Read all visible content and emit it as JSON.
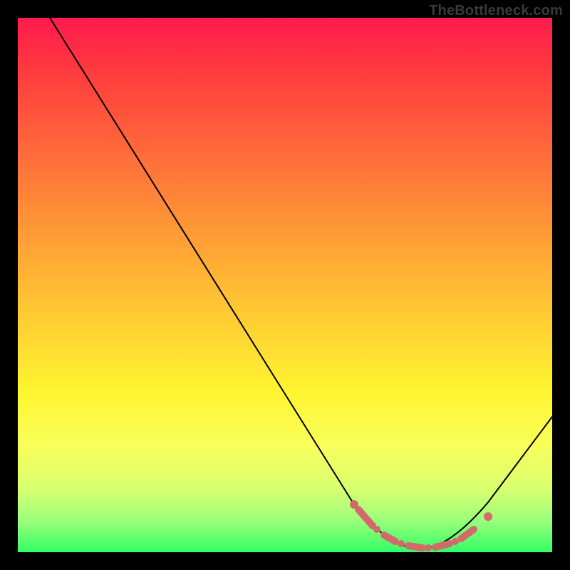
{
  "watermark": "TheBottleneck.com",
  "colors": {
    "page_bg": "#000000",
    "gradient_top": "#ff1a4d",
    "gradient_bottom": "#33ff66",
    "curve": "#000000",
    "marker": "#d16b6b"
  },
  "chart_data": {
    "type": "line",
    "title": "",
    "xlabel": "",
    "ylabel": "",
    "xlim": [
      0,
      100
    ],
    "ylim": [
      0,
      100
    ],
    "x": [
      6,
      12,
      18,
      24,
      30,
      36,
      42,
      48,
      54,
      60,
      64,
      68,
      72,
      75,
      78,
      81,
      84,
      88,
      92,
      96,
      100
    ],
    "values": [
      100,
      91,
      82,
      73,
      64,
      55,
      46,
      37,
      28,
      19,
      13,
      8,
      4,
      2,
      1,
      1,
      2,
      5,
      10,
      17,
      25
    ],
    "marker_x": [
      64,
      68,
      70,
      72,
      74,
      76,
      78,
      80,
      82,
      84,
      86,
      88
    ],
    "marker_y": [
      13,
      7,
      5,
      3.5,
      2.5,
      1.5,
      1,
      1,
      1.5,
      2.2,
      3.3,
      5
    ],
    "annotations": []
  }
}
